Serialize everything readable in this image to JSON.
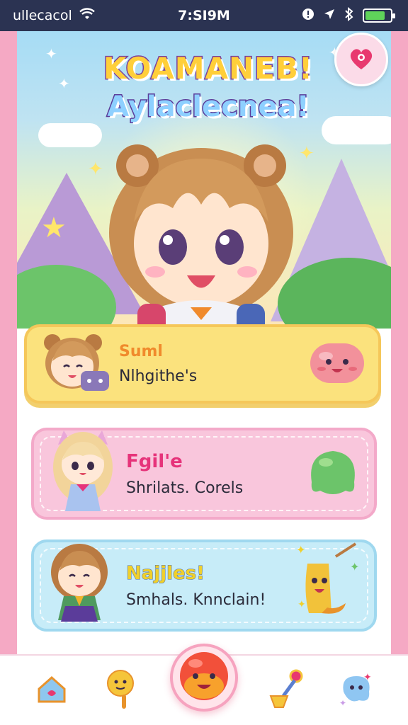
{
  "status_bar": {
    "carrier": "ullecacol",
    "time": "7:SI9M",
    "battery_level": 0.8
  },
  "hero": {
    "title_line_1": "KOAMANEB!",
    "title_line_2": "Aylaclecnea!",
    "corner_icon": "heart-candy-icon"
  },
  "cards": [
    {
      "name": "Suml",
      "subtitle": "Nlhgithe's",
      "avatar_icon": "brown-hair-girl-avatar",
      "badge_icon": "pink-blob-icon",
      "color": "#fbe27d"
    },
    {
      "name": "Fgil'e",
      "subtitle": "Shrilats. Corels",
      "avatar_icon": "blonde-cat-girl-avatar",
      "badge_icon": "green-blob-icon",
      "color": "#f9c6dc"
    },
    {
      "name": "Najjles!",
      "subtitle": "Smhals. Knnclain!",
      "avatar_icon": "winking-girl-avatar",
      "badge_icon": "banana-mascot-icon",
      "color": "#c7ecf8"
    }
  ],
  "tab_bar": {
    "tabs": [
      {
        "icon": "home-icon"
      },
      {
        "icon": "lollipop-icon"
      },
      {
        "icon": "smiley-center-icon"
      },
      {
        "icon": "magic-wand-icon"
      },
      {
        "icon": "sparkle-blob-icon"
      }
    ]
  }
}
